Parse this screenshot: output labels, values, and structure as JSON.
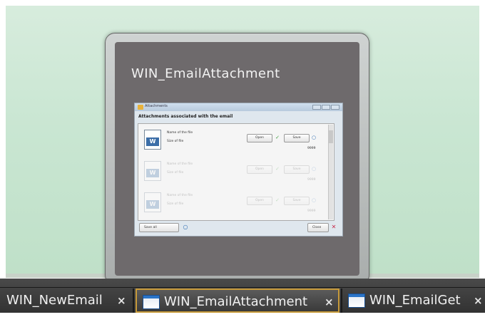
{
  "preview": {
    "title": "WIN_EmailAttachment",
    "mini_window": {
      "title": "Attachments",
      "header": "Attachments associated with the email",
      "items": [
        {
          "name_label": "Name of the file",
          "size_label": "Size of file",
          "open_label": "Open",
          "save_label": "Save",
          "size_value": "9999"
        },
        {
          "name_label": "Name of the file",
          "size_label": "Size of file",
          "open_label": "Open",
          "save_label": "Save",
          "size_value": "9999"
        },
        {
          "name_label": "Name of the file",
          "size_label": "Size of file",
          "open_label": "Open",
          "save_label": "Save",
          "size_value": "9999"
        }
      ],
      "save_all_label": "Save all",
      "close_label": "Close"
    }
  },
  "taskbar": {
    "tabs": [
      {
        "label": "WIN_NewEmail",
        "active": false
      },
      {
        "label": "WIN_EmailAttachment",
        "active": true
      },
      {
        "label": "WIN_EmailGet",
        "active": false
      }
    ],
    "close_glyph": "×"
  },
  "icons": {
    "file": "word-document-icon",
    "tab_window": "window-icon",
    "open": "checkmark-icon",
    "save": "magnifier-icon",
    "close": "close-icon"
  },
  "colors": {
    "active_tab_border": "#c79a3a",
    "taskbar": "#3a3a3a",
    "preview_panel": "#6e6a6c"
  }
}
